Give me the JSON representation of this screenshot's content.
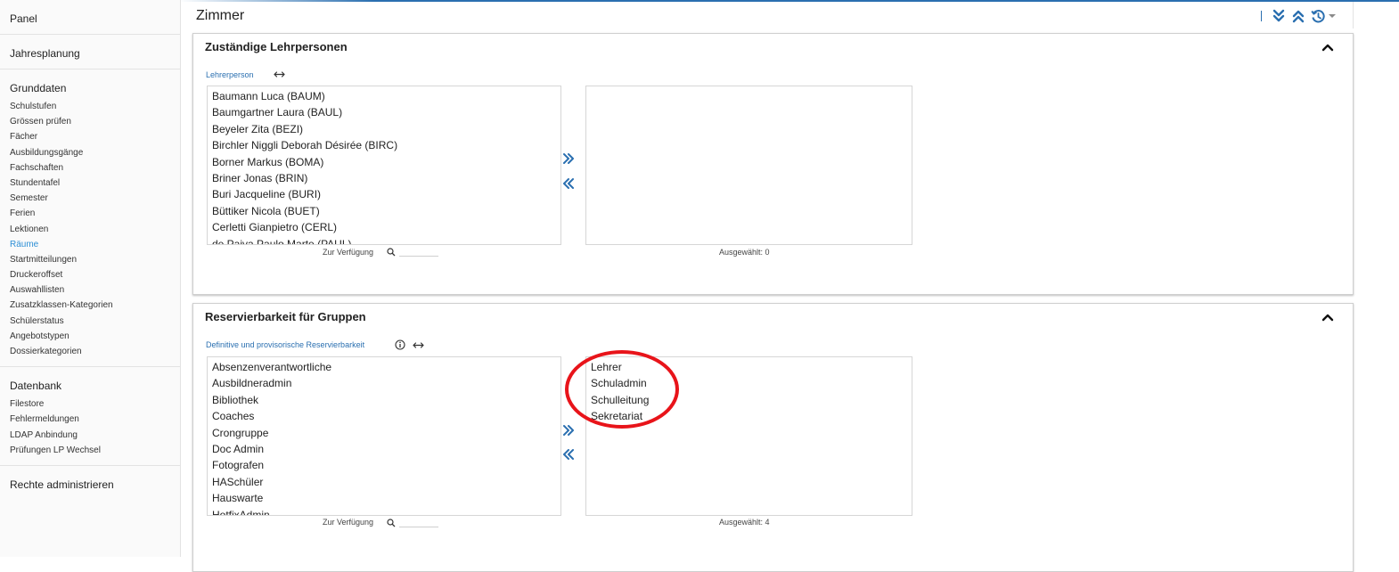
{
  "sidebar": {
    "panel": "Panel",
    "jahresplanung": "Jahresplanung",
    "grunddaten": {
      "title": "Grunddaten",
      "items": [
        "Schulstufen",
        "Grössen prüfen",
        "Fächer",
        "Ausbildungsgänge",
        "Fachschaften",
        "Stundentafel",
        "Semester",
        "Ferien",
        "Lektionen",
        "Räume",
        "Startmitteilungen",
        "Druckeroffset",
        "Auswahllisten",
        "Zusatzklassen-Kategorien",
        "Schülerstatus",
        "Angebotstypen",
        "Dossierkategorien"
      ],
      "active_item": "Räume"
    },
    "datenbank": {
      "title": "Datenbank",
      "items": [
        "Filestore",
        "Fehlermeldungen",
        "LDAP Anbindung",
        "Prüfungen LP Wechsel"
      ]
    },
    "rechte": "Rechte administrieren"
  },
  "main": {
    "title": "Zimmer"
  },
  "toolbar_icons": [
    "expand-all-icon",
    "collapse-all-icon",
    "history-icon",
    "caret-down-icon"
  ],
  "colors": {
    "accent": "#2a6fb0",
    "active_link": "#2d8fd5",
    "highlight": "#e8141a"
  },
  "panels": {
    "lehrpersonen": {
      "title": "Zuständige Lehrpersonen",
      "field_label": "Lehrerperson",
      "available": [
        "Baumann Luca (BAUM)",
        "Baumgartner Laura (BAUL)",
        "Beyeler Zita (BEZI)",
        "Birchler Niggli Deborah Désirée (BIRC)",
        "Borner Markus (BOMA)",
        "Briner Jonas (BRIN)",
        "Buri Jacqueline (BURI)",
        "Büttiker Nicola (BUET)",
        "Cerletti Gianpietro (CERL)",
        "de Paiva Paulo Marte (PAUL)"
      ],
      "selected": [],
      "available_caption": "Zur Verfügung",
      "selected_caption": "Ausgewählt: 0"
    },
    "gruppen": {
      "title": "Reservierbarkeit für Gruppen",
      "field_label": "Definitive und provisorische Reservierbarkeit",
      "available": [
        "Absenzenverantwortliche",
        "Ausbildneradmin",
        "Bibliothek",
        "Coaches",
        "Crongruppe",
        "Doc Admin",
        "Fotografen",
        "HASchüler",
        "Hauswarte",
        "HotfixAdmin"
      ],
      "selected": [
        "Lehrer",
        "Schuladmin",
        "Schulleitung",
        "Sekretariat"
      ],
      "available_caption": "Zur Verfügung",
      "selected_caption": "Ausgewählt: 4"
    }
  }
}
